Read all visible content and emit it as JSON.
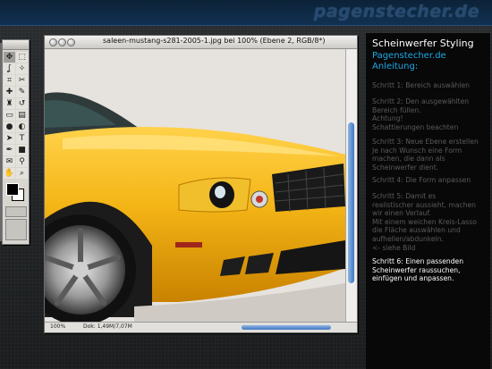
{
  "site": {
    "brand": "pagenstecher.de"
  },
  "document": {
    "title": "saleen-mustang-s281-2005-1.jpg bei 100% (Ebene 2, RGB/8*)",
    "zoom": "100%",
    "doc_size": "Dok: 1,49M/7,07M"
  },
  "toolbox": {
    "tools": [
      "move",
      "marquee",
      "lasso",
      "magic-wand",
      "crop",
      "slice",
      "healing",
      "brush",
      "stamp",
      "history",
      "eraser",
      "gradient",
      "blur",
      "dodge",
      "path-select",
      "type",
      "pen",
      "shape",
      "notes",
      "eyedropper",
      "hand",
      "zoom"
    ]
  },
  "panel": {
    "title": "Scheinwerfer Styling",
    "site": "Pagenstecher.de",
    "subtitle": "Anleitung:",
    "steps": [
      {
        "text": "Schritt 1: Bereich auswählen",
        "active": false
      },
      {
        "text": "Schritt 2: Den ausgewählten\nBereich füllen.\nAchtung!\nSchattierungen beachten",
        "active": false
      },
      {
        "text": "Schritt 3: Neue Ebene erstellen\nJe nach Wunsch eine Form\nmachen, die dann als\nScheinwerfer dient.",
        "active": false
      },
      {
        "text": "Schritt 4: Die Form anpassen",
        "active": false
      },
      {
        "text": "Schritt 5: Damit es\nrealistischer aussieht, machen\nwir einen Verlauf.\nMit einem weichen Kreis-Lasso\ndie Fläche auswählen und\naufhellen/abdunkeln.\n<- siehe Bild",
        "active": false
      },
      {
        "text": "Schritt 6: Einen passenden\nScheinwerfer raussuchen,\neinfügen und anpassen.",
        "active": true
      }
    ]
  },
  "colors": {
    "accent": "#1da8e6",
    "car_body": "#f2b418",
    "brand_bar": "#0f2b48"
  }
}
